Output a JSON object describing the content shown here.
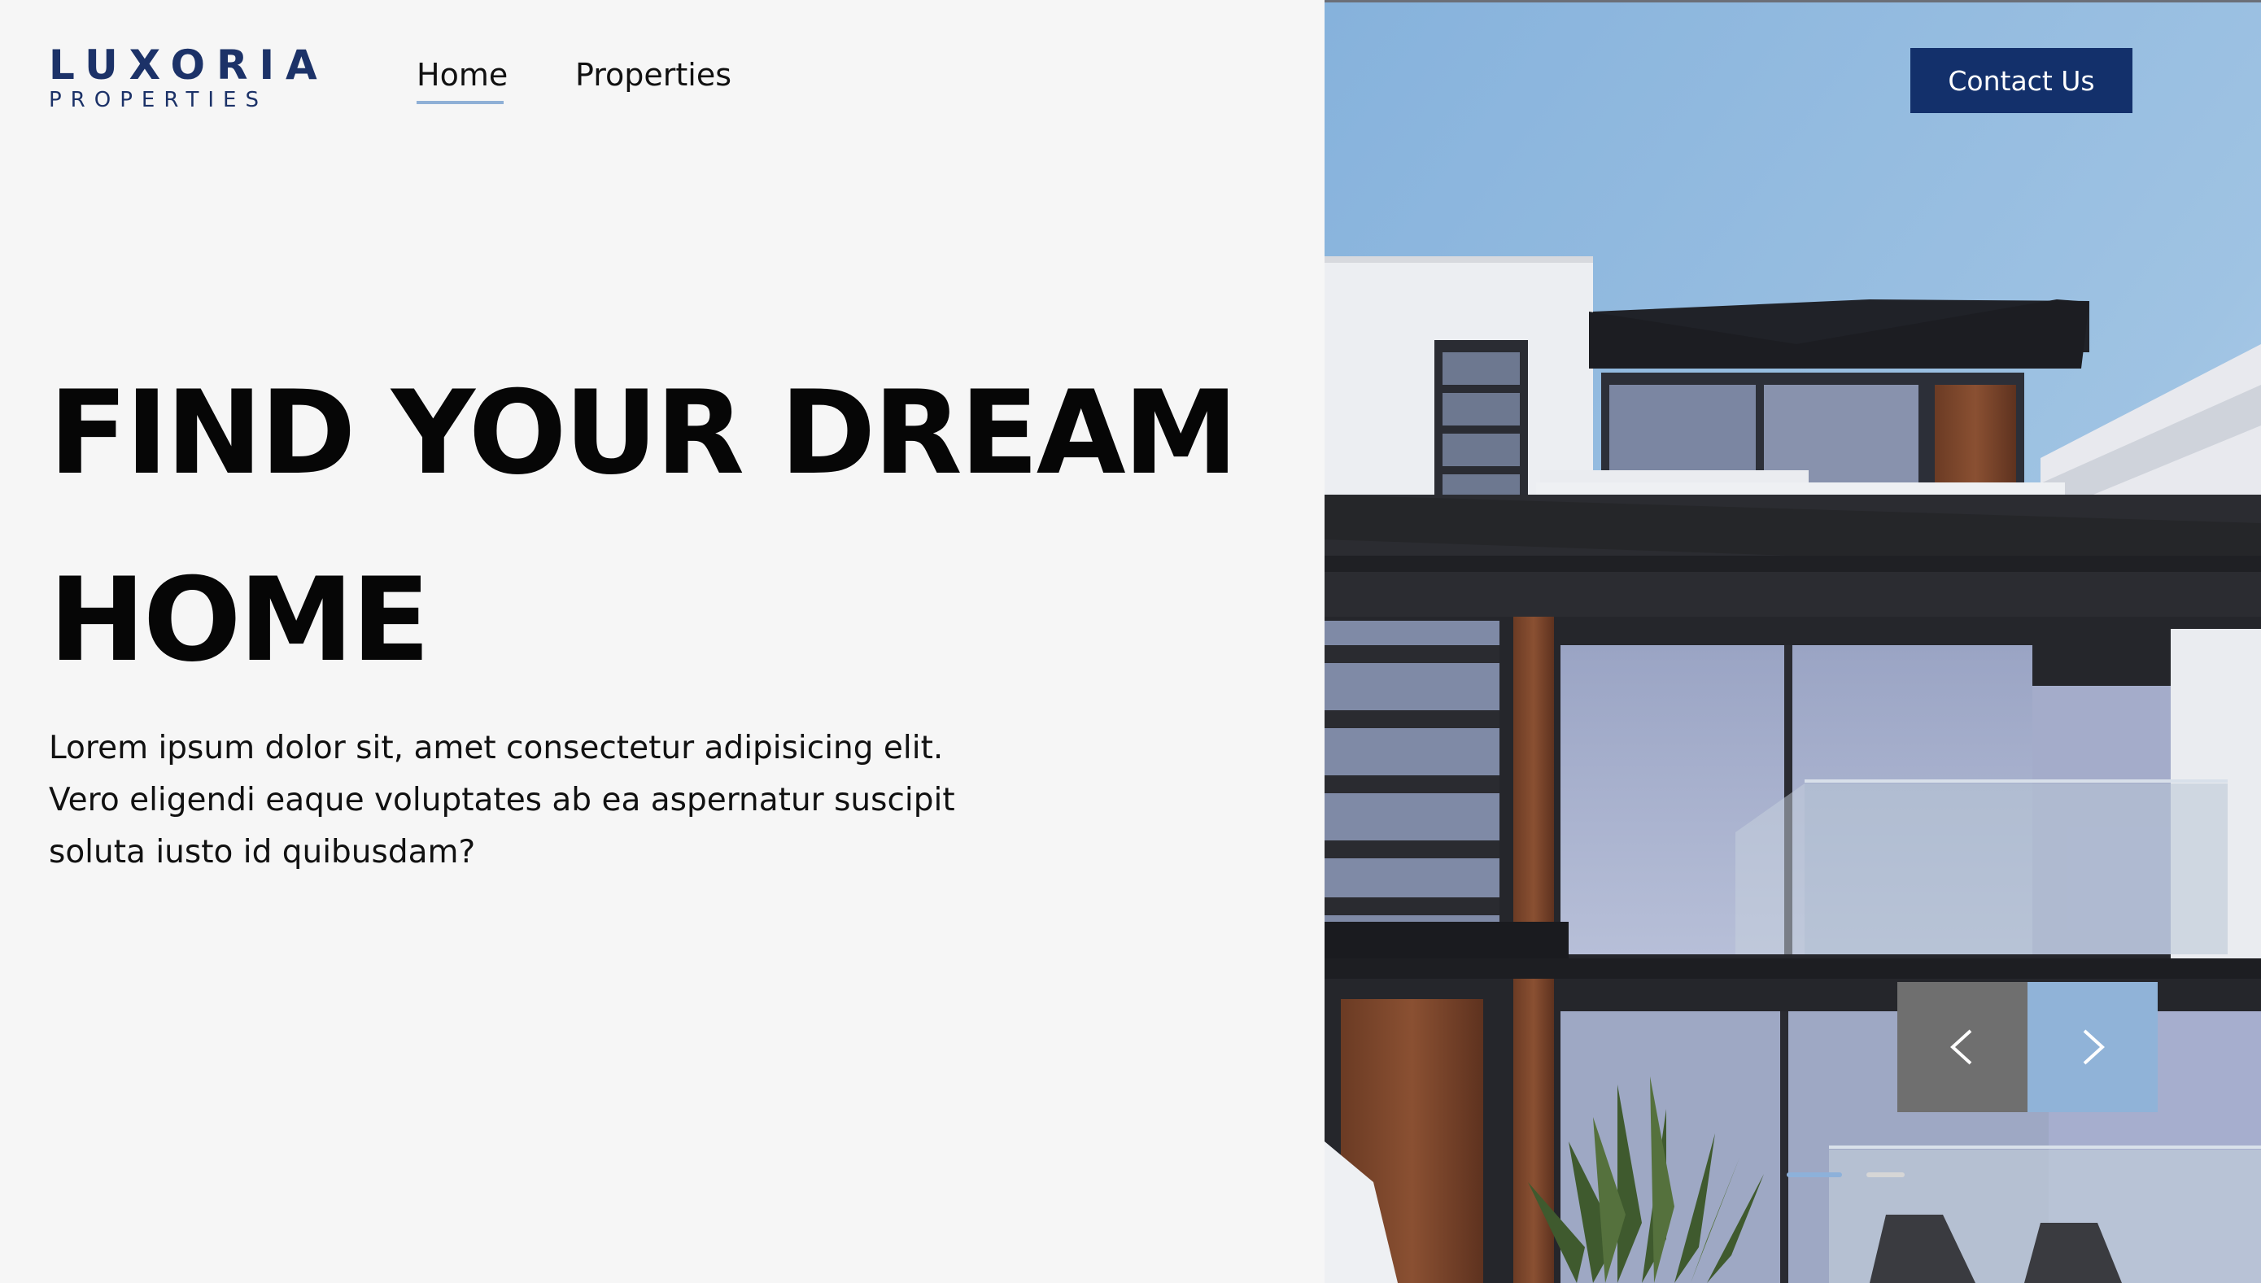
{
  "brand": {
    "name": "LUXORIA",
    "tagline": "PROPERTIES",
    "color": "#1c3268"
  },
  "nav": {
    "items": [
      {
        "label": "Home",
        "active": true
      },
      {
        "label": "Properties",
        "active": false
      }
    ],
    "active_underline_color": "#8fb0d6"
  },
  "header": {
    "contact_label": "Contact Us",
    "contact_color": "#13306b"
  },
  "hero": {
    "title_lines": [
      "FIND YOUR DREAM",
      "HOME"
    ],
    "body_lines": [
      "Lorem ipsum dolor sit, amet consectetur adipisicing elit.",
      "Vero eligendi eaque voluptates ab ea aspernatur suscipit",
      "soluta iusto id quibusdam?"
    ]
  },
  "slider": {
    "prev_icon": "chevron-left-icon",
    "next_icon": "chevron-right-icon",
    "slide_count": 2,
    "active_slide": 1,
    "image": "modern-house-photo"
  }
}
